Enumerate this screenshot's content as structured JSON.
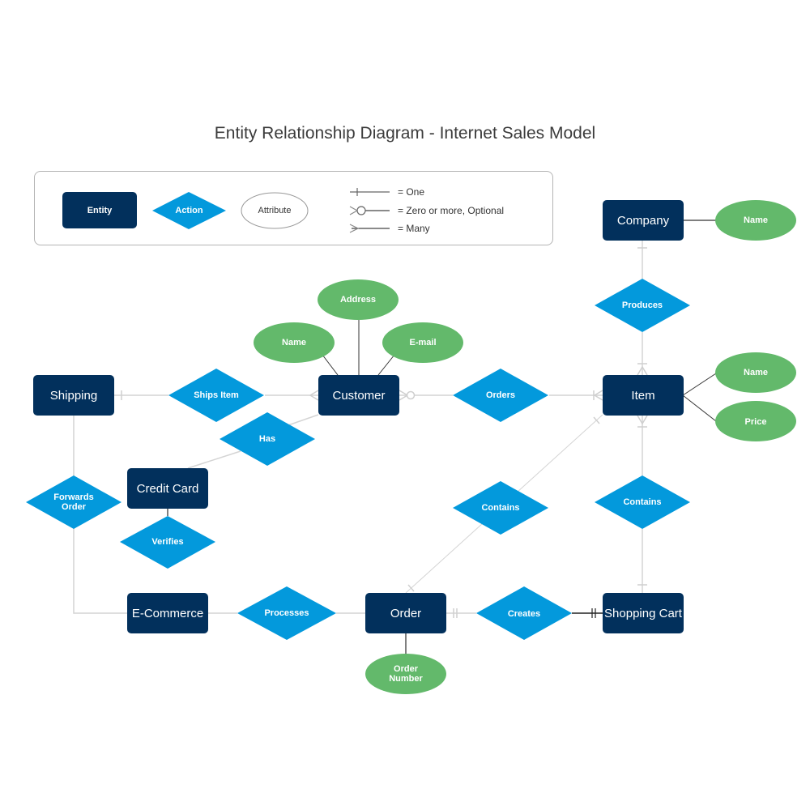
{
  "title": "Entity Relationship Diagram - Internet Sales Model",
  "colors": {
    "entity": "#02305c",
    "action": "#0399dc",
    "attribute": "#63b96b",
    "relationship_line": "#d4d4d4",
    "attribute_line": "#333333"
  },
  "legend": {
    "entity_label": "Entity",
    "action_label": "Action",
    "attribute_label": "Attribute",
    "notations": [
      {
        "symbol": "one",
        "label": "= One"
      },
      {
        "symbol": "zero-or-more",
        "label": "= Zero or more, Optional"
      },
      {
        "symbol": "many",
        "label": "= Many"
      }
    ]
  },
  "entities": {
    "company": "Company",
    "item": "Item",
    "customer": "Customer",
    "shipping": "Shipping",
    "credit_card": "Credit Card",
    "ecommerce": "E-Commerce",
    "order": "Order",
    "shopping_cart": "Shopping Cart"
  },
  "actions": {
    "produces": "Produces",
    "ships_item": "Ships Item",
    "orders": "Orders",
    "has": "Has",
    "forwards_order": "Forwards Order",
    "verifies": "Verifies",
    "contains_order": "Contains",
    "contains_cart": "Contains",
    "processes": "Processes",
    "creates": "Creates"
  },
  "attributes": {
    "company_name": "Name",
    "item_name": "Name",
    "item_price": "Price",
    "customer_address": "Address",
    "customer_name": "Name",
    "customer_email": "E-mail",
    "order_number": "Order Number"
  },
  "relationships": [
    {
      "from": "Company",
      "action": "Produces",
      "to": "Item",
      "from_card": "one",
      "to_card": "many"
    },
    {
      "from": "Shipping",
      "action": "Ships Item",
      "to": "Customer",
      "from_card": "one",
      "to_card": "many"
    },
    {
      "from": "Customer",
      "action": "Orders",
      "to": "Item",
      "from_card": "zero-or-more",
      "to_card": "many"
    },
    {
      "from": "Customer",
      "action": "Has",
      "to": "Credit Card",
      "from_card": "",
      "to_card": ""
    },
    {
      "from": "Shipping",
      "action": "Forwards Order",
      "to": "E-Commerce",
      "from_card": "",
      "to_card": ""
    },
    {
      "from": "Credit Card",
      "action": "Verifies",
      "to": "",
      "from_card": "",
      "to_card": ""
    },
    {
      "from": "Order",
      "action": "Contains",
      "to": "Item",
      "from_card": "one",
      "to_card": "many"
    },
    {
      "from": "Shopping Cart",
      "action": "Contains",
      "to": "Item",
      "from_card": "one",
      "to_card": "many"
    },
    {
      "from": "E-Commerce",
      "action": "Processes",
      "to": "Order",
      "from_card": "",
      "to_card": ""
    },
    {
      "from": "Order",
      "action": "Creates",
      "to": "Shopping Cart",
      "from_card": "one-and-only-one",
      "to_card": "one-and-only-one"
    }
  ]
}
